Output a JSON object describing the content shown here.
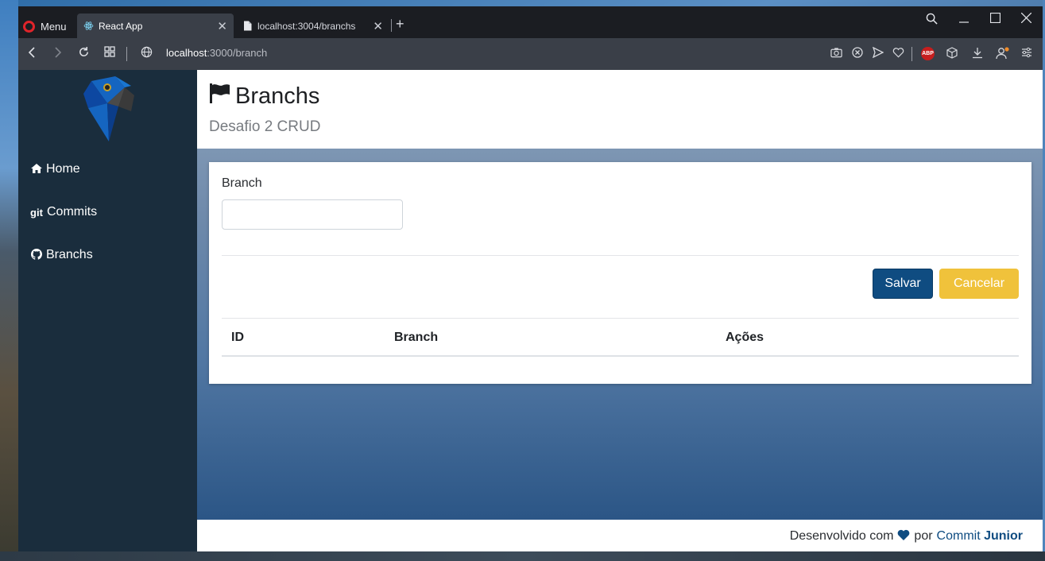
{
  "browser": {
    "menu_label": "Menu",
    "tabs": [
      {
        "title": "React App",
        "icon": "react-icon",
        "active": true
      },
      {
        "title": "localhost:3004/branchs",
        "icon": "file-icon",
        "active": false
      }
    ],
    "url_host": "localhost",
    "url_rest": ":3000/branch",
    "adblock_label": "ABP"
  },
  "sidebar": {
    "items": [
      {
        "label": "Home",
        "icon": "home-icon"
      },
      {
        "label": "Commits",
        "icon": "git-icon",
        "icon_text": "git"
      },
      {
        "label": "Branchs",
        "icon": "github-icon"
      }
    ]
  },
  "header": {
    "title": "Branchs",
    "subtitle": "Desafio 2 CRUD",
    "icon": "flag-icon"
  },
  "form": {
    "label": "Branch",
    "value": "",
    "placeholder": "",
    "save_label": "Salvar",
    "cancel_label": "Cancelar"
  },
  "table": {
    "columns": [
      "ID",
      "Branch",
      "Ações"
    ],
    "rows": []
  },
  "footer": {
    "prefix": "Desenvolvido com",
    "middle": "por",
    "brand_main": "Commit",
    "brand_rest": "Junior"
  },
  "colors": {
    "primary": "#0f4c81",
    "warning": "#f0c23b",
    "sidebar": "#1a2d3d"
  }
}
